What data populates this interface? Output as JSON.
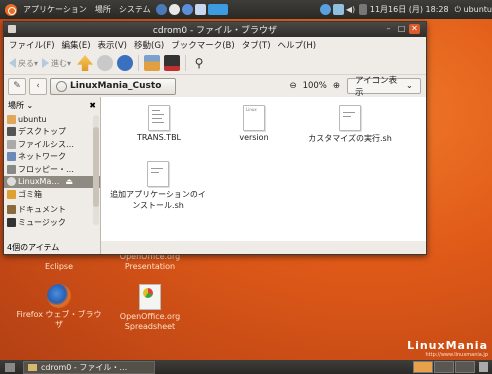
{
  "top_panel": {
    "menus": [
      "アプリケーション",
      "場所",
      "システム"
    ],
    "clock": "11月16日 (月) 18:28",
    "user": "ubuntu"
  },
  "window": {
    "title": "cdrom0 - ファイル・ブラウザ",
    "controls": {
      "minimize": "–",
      "maximize": "□",
      "close": "✕"
    },
    "menu": [
      "ファイル(F)",
      "編集(E)",
      "表示(V)",
      "移動(G)",
      "ブックマーク(B)",
      "タブ(T)",
      "ヘルプ(H)"
    ],
    "toolbar": {
      "back": "戻る",
      "forward": "進む"
    },
    "location": {
      "path": "LinuxMania_Custo",
      "zoom": "100%",
      "view_mode": "アイコン表示"
    },
    "sidebar": {
      "header": "場所",
      "close": "✖",
      "items": [
        {
          "label": "ubuntu",
          "icon": "home-icon",
          "color": "#e2a65a"
        },
        {
          "label": "デスクトップ",
          "icon": "desktop-icon",
          "color": "#555"
        },
        {
          "label": "ファイルシス…",
          "icon": "drive-icon",
          "color": "#aaa"
        },
        {
          "label": "ネットワーク",
          "icon": "network-icon",
          "color": "#6b8ab8"
        },
        {
          "label": "フロッピー・…",
          "icon": "floppy-icon",
          "color": "#888"
        },
        {
          "label": "LinuxMa…",
          "icon": "cdrom-icon",
          "color": "#ddd",
          "selected": true
        },
        {
          "label": "ゴミ箱",
          "icon": "trash-icon",
          "color": "#e0a030"
        },
        {
          "label": "ドキュメント",
          "icon": "documents-icon",
          "color": "#8a6a3a"
        },
        {
          "label": "ミュージック",
          "icon": "music-icon",
          "color": "#333"
        }
      ]
    },
    "status": "4個のアイテム",
    "files": [
      {
        "name": "TRANS.TBL"
      },
      {
        "name": "version",
        "icon_label": "Linux"
      },
      {
        "name": "カスタマイズの実行.sh"
      },
      {
        "name": "追加アプリケーションのインストール.sh"
      }
    ]
  },
  "desktop": {
    "icons": [
      {
        "label": "Eclipse"
      },
      {
        "label": "OpenOffice.org Presentation"
      },
      {
        "label": "Firefox ウェブ・ブラウザ"
      },
      {
        "label": "OpenOffice.org Spreadsheet"
      }
    ],
    "watermark": {
      "brand": "LinuxMania",
      "url": "http://www.linuxmania.jp"
    }
  },
  "bottom_panel": {
    "task": "cdrom0 - ファイル・…"
  }
}
